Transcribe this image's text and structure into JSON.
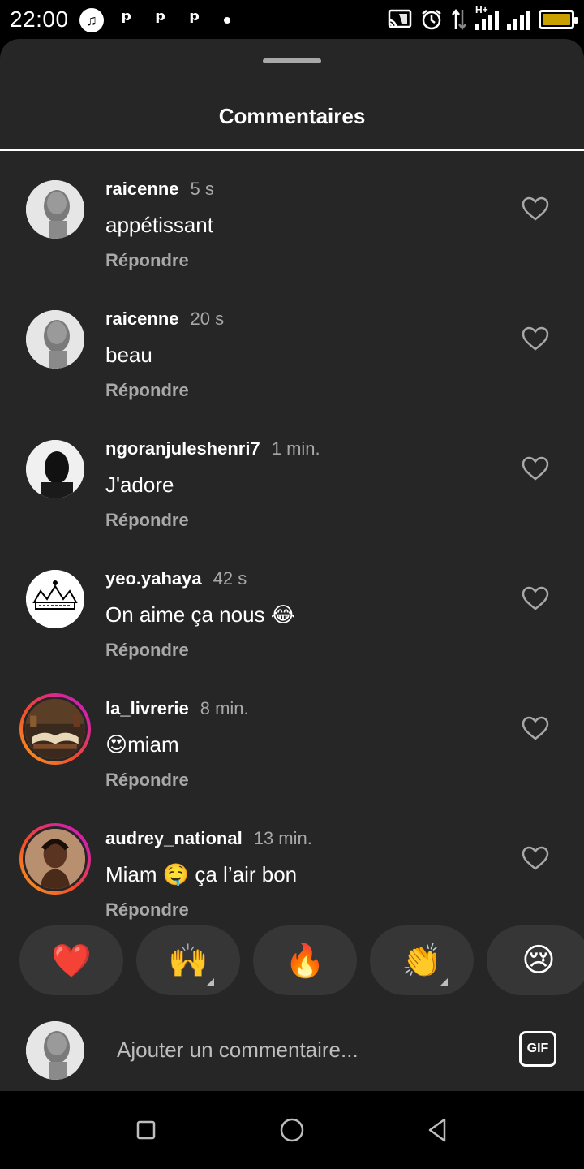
{
  "status_bar": {
    "time": "22:00",
    "left_icons": [
      "music-icon",
      "p-icon",
      "p-icon",
      "p-icon",
      "dot-icon"
    ],
    "right_icons": [
      "cast-icon",
      "alarm-icon",
      "data-arrows-icon",
      "signal-h-plus-icon",
      "signal-icon",
      "battery-icon"
    ],
    "network_label": "H+",
    "battery_color": "#c8a100"
  },
  "sheet": {
    "title": "Commentaires"
  },
  "comments": [
    {
      "user": "raicenne",
      "time": "5 s",
      "text": "appétissant",
      "reply": "Répondre",
      "avatar": "selfie-avatar",
      "ring": false
    },
    {
      "user": "raicenne",
      "time": "20 s",
      "text": "beau",
      "reply": "Répondre",
      "avatar": "selfie-avatar",
      "ring": false
    },
    {
      "user": "ngoranjuleshenri7",
      "time": "1 min.",
      "text": "J'adore",
      "reply": "Répondre",
      "avatar": "dark-portrait-avatar",
      "ring": false
    },
    {
      "user": "yeo.yahaya",
      "time": "42 s",
      "text": "On aime ça nous 😂",
      "reply": "Répondre",
      "avatar": "crown-avatar",
      "ring": false
    },
    {
      "user": "la_livrerie",
      "time": "8 min.",
      "text": "😍miam",
      "reply": "Répondre",
      "avatar": "books-avatar",
      "ring": true
    },
    {
      "user": "audrey_national",
      "time": "13 min.",
      "text": "Miam 🤤 ça l’air bon",
      "reply": "Répondre",
      "avatar": "woman-portrait-avatar",
      "ring": true
    }
  ],
  "reactions": [
    {
      "emoji": "❤️",
      "name": "heart",
      "has_more": false
    },
    {
      "emoji": "🙌",
      "name": "raising-hands",
      "has_more": true
    },
    {
      "emoji": "🔥",
      "name": "fire",
      "has_more": false
    },
    {
      "emoji": "👏",
      "name": "clapping-hands",
      "has_more": true
    },
    {
      "emoji": "😢",
      "name": "crying-face",
      "has_more": false
    }
  ],
  "composer": {
    "placeholder": "Ajouter un commentaire...",
    "gif_label": "GIF"
  },
  "nav_bar": {
    "buttons": [
      "recents-square-icon",
      "home-circle-icon",
      "back-triangle-icon"
    ]
  },
  "colors": {
    "sheet_bg": "#262626",
    "secondary_text": "#a8a8a8",
    "reaction_bg": "#363636",
    "story_ring": [
      "#f7a21b",
      "#d6249f"
    ]
  }
}
